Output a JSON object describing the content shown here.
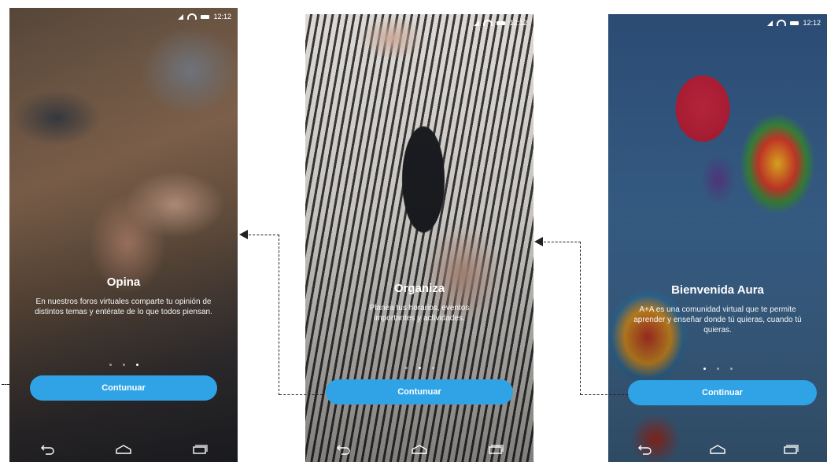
{
  "screens": [
    {
      "status_time": "12:12",
      "title": "Opina",
      "description": "En nuestros foros virtuales comparte tu opinión de distintos temas y entérate de lo que todos piensan.",
      "button": "Contunuar",
      "dots": {
        "count": 3,
        "active": 2
      }
    },
    {
      "status_time": "12:12",
      "title": "Organiza",
      "description": "Planea tus horarios, eventos importantes y actividades.",
      "button": "Contunuar",
      "dots": {
        "count": 3,
        "active": 1
      }
    },
    {
      "status_time": "12:12",
      "title": "Bienvenida Aura",
      "description": "A+A es una comunidad virtual que te permite aprender y enseñar donde tú quieras, cuando tú quieras.",
      "button": "Continuar",
      "dots": {
        "count": 3,
        "active": 0
      }
    }
  ],
  "icons": [
    "signal-icon",
    "wifi-icon",
    "battery-icon",
    "back-icon",
    "home-icon",
    "recents-icon",
    "arrow-left-icon"
  ],
  "colors": {
    "button": "#2fa3e6",
    "text": "#ffffff",
    "connector": "#222222"
  }
}
